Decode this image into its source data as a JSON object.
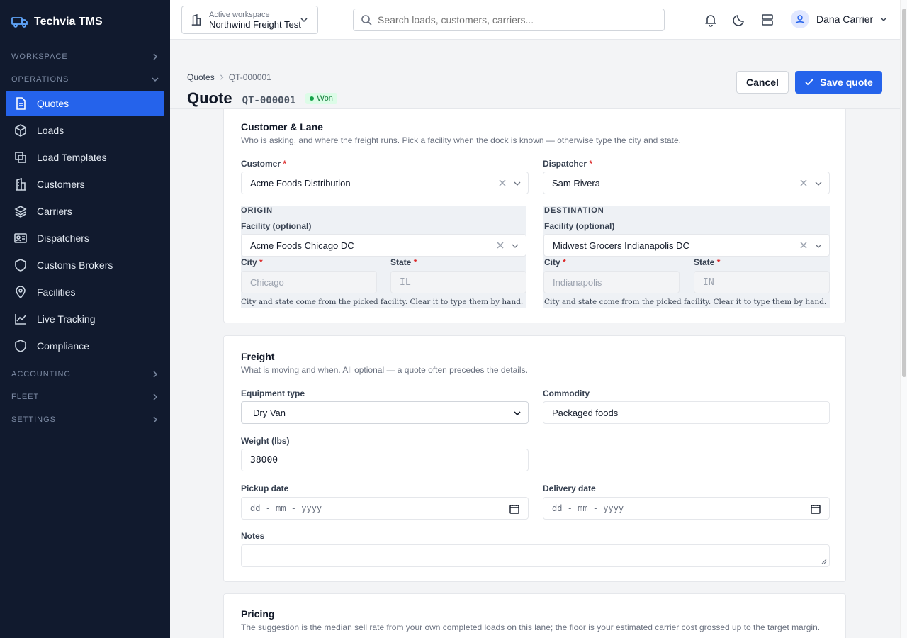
{
  "brand": "Techvia TMS",
  "sidebar": {
    "sections": {
      "workspace": "WORKSPACE",
      "operations": "OPERATIONS",
      "accounting": "ACCOUNTING",
      "fleet": "FLEET",
      "settings": "SETTINGS"
    },
    "items": [
      {
        "label": "Quotes",
        "icon": "file-icon"
      },
      {
        "label": "Loads",
        "icon": "box-icon"
      },
      {
        "label": "Load Templates",
        "icon": "copy-icon"
      },
      {
        "label": "Customers",
        "icon": "building-icon"
      },
      {
        "label": "Carriers",
        "icon": "layers-icon"
      },
      {
        "label": "Dispatchers",
        "icon": "id-card-icon"
      },
      {
        "label": "Customs Brokers",
        "icon": "shield-icon"
      },
      {
        "label": "Facilities",
        "icon": "map-pin-icon"
      },
      {
        "label": "Live Tracking",
        "icon": "chart-line-icon"
      },
      {
        "label": "Compliance",
        "icon": "shield-icon"
      }
    ]
  },
  "topbar": {
    "workspace_small": "Active workspace",
    "workspace_name": "Northwind Freight Test",
    "search_placeholder": "Search loads, customers, carriers...",
    "user_name": "Dana Carrier"
  },
  "header": {
    "breadcrumb_root": "Quotes",
    "breadcrumb_current": "QT-000001",
    "title": "Quote",
    "quote_id": "QT-000001",
    "status": "Won",
    "cancel": "Cancel",
    "save": "Save quote"
  },
  "customer_lane": {
    "title": "Customer & Lane",
    "subtitle": "Who is asking, and where the freight runs. Pick a facility when the dock is known — otherwise type the city and state.",
    "customer_label": "Customer",
    "customer_value": "Acme Foods Distribution",
    "dispatcher_label": "Dispatcher",
    "dispatcher_value": "Sam Rivera",
    "origin": {
      "title": "ORIGIN",
      "facility_label": "Facility (optional)",
      "facility_value": "Acme Foods Chicago DC",
      "city_label": "City",
      "city_value": "Chicago",
      "state_label": "State",
      "state_value": "IL",
      "hint": "City and state come from the picked facility. Clear it to type them by hand."
    },
    "destination": {
      "title": "DESTINATION",
      "facility_label": "Facility (optional)",
      "facility_value": "Midwest Grocers Indianapolis DC",
      "city_label": "City",
      "city_value": "Indianapolis",
      "state_label": "State",
      "state_value": "IN",
      "hint": "City and state come from the picked facility. Clear it to type them by hand."
    }
  },
  "freight": {
    "title": "Freight",
    "subtitle": "What is moving and when. All optional — a quote often precedes the details.",
    "equipment_label": "Equipment type",
    "equipment_value": "Dry Van",
    "commodity_label": "Commodity",
    "commodity_value": "Packaged foods",
    "weight_label": "Weight (lbs)",
    "weight_value": "38000",
    "pickup_label": "Pickup date",
    "pickup_placeholder": "dd - mm - yyyy",
    "delivery_label": "Delivery date",
    "delivery_placeholder": "dd - mm - yyyy",
    "notes_label": "Notes"
  },
  "pricing": {
    "title": "Pricing",
    "subtitle": "The suggestion is the median sell rate from your own completed loads on this lane; the floor is your estimated carrier cost grossed up to the target margin."
  }
}
